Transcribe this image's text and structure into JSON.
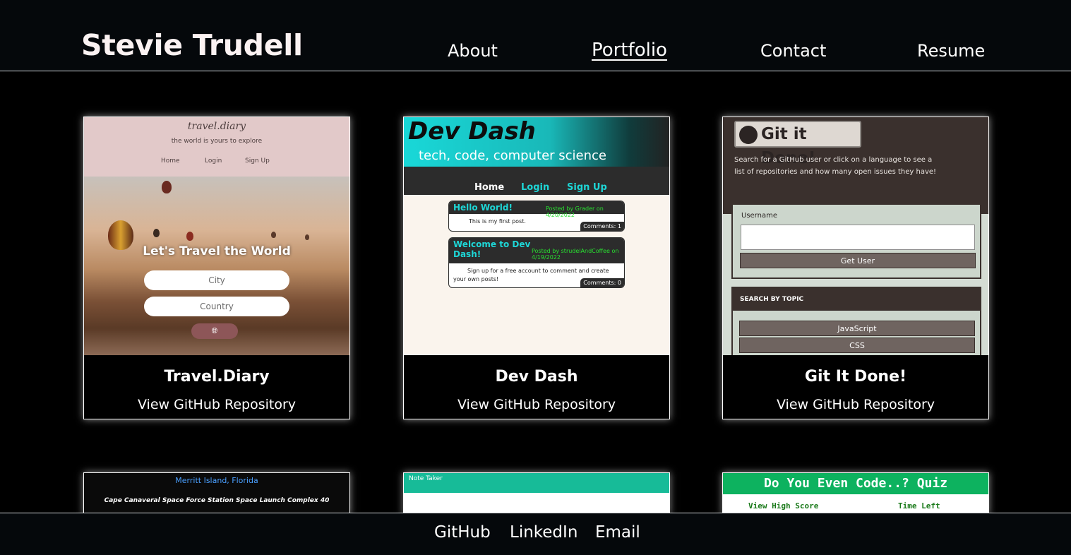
{
  "header": {
    "brand": "Stevie Trudell",
    "nav": [
      {
        "label": "About"
      },
      {
        "label": "Portfolio"
      },
      {
        "label": "Contact"
      },
      {
        "label": "Resume"
      }
    ]
  },
  "projects": [
    {
      "title": "Travel.Diary",
      "link": "View GitHub Repository",
      "shot": {
        "logo": "travel.diary",
        "tagline": "the world is yours to explore",
        "nav": [
          "Home",
          "Login",
          "Sign Up"
        ],
        "heading": "Let's Travel the World",
        "city_placeholder": "City",
        "country_placeholder": "Country",
        "button_icon": "globe-icon"
      }
    },
    {
      "title": "Dev Dash",
      "link": "View GitHub Repository",
      "shot": {
        "title": "Dev Dash",
        "subtitle": "tech, code, computer science",
        "nav": [
          "Home",
          "Login",
          "Sign Up"
        ],
        "posts": [
          {
            "title": "Hello World!",
            "meta": "Posted by Grader on 4/20/2022",
            "body": "This is my first post.",
            "comments": "Comments: 1"
          },
          {
            "title": "Welcome to Dev Dash!",
            "meta": "Posted by strudelAndCoffee on 4/19/2022",
            "body": "Sign up for a free account to comment and create your own posts!",
            "comments": "Comments: 0"
          }
        ]
      }
    },
    {
      "title": "Git It Done!",
      "link": "View GitHub Repository",
      "shot": {
        "logo": "Git it Done!",
        "description_line1": "Search for a GitHub user or click on a language to see a",
        "description_line2": "list of repositories and how many open issues they have!",
        "username_label": "Username",
        "get_user": "Get User",
        "topic_heading": "SEARCH BY TOPIC",
        "topics": [
          "JavaScript",
          "CSS"
        ]
      }
    },
    {
      "shot": {
        "line1": "Merritt Island, Florida",
        "line2": "Cape Canaveral Space Force Station Space Launch Complex 40"
      }
    },
    {
      "shot": {
        "title": "Note Taker"
      }
    },
    {
      "shot": {
        "title": "Do You Even Code..? Quiz",
        "left": "View High Score",
        "right": "Time Left"
      }
    }
  ],
  "footer": {
    "links": [
      {
        "label": "GitHub"
      },
      {
        "label": "LinkedIn"
      },
      {
        "label": "Email"
      }
    ]
  },
  "colors": {
    "background": "#000000",
    "header_bg": "#05080b",
    "text": "#ffffff"
  }
}
